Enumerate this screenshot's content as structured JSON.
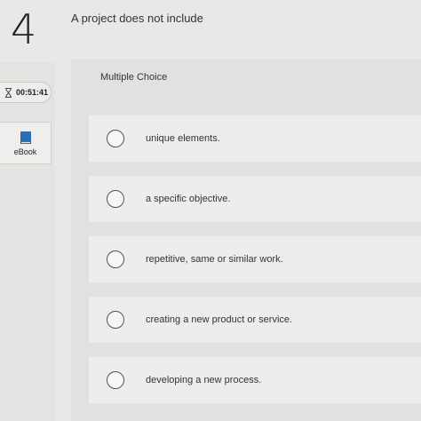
{
  "question": {
    "number": "4",
    "prompt": "A project does not include"
  },
  "sidebar": {
    "timer": "00:51:41",
    "ebook_label": "eBook"
  },
  "quiz": {
    "type_label": "Multiple Choice",
    "options": [
      "unique elements.",
      "a specific objective.",
      "repetitive, same or similar work.",
      "creating a new product or service.",
      "developing a new process."
    ]
  },
  "colors": {
    "background": "#e9e8e6",
    "option_background": "#ededeb",
    "ebook_icon": "#2a6fb3"
  }
}
